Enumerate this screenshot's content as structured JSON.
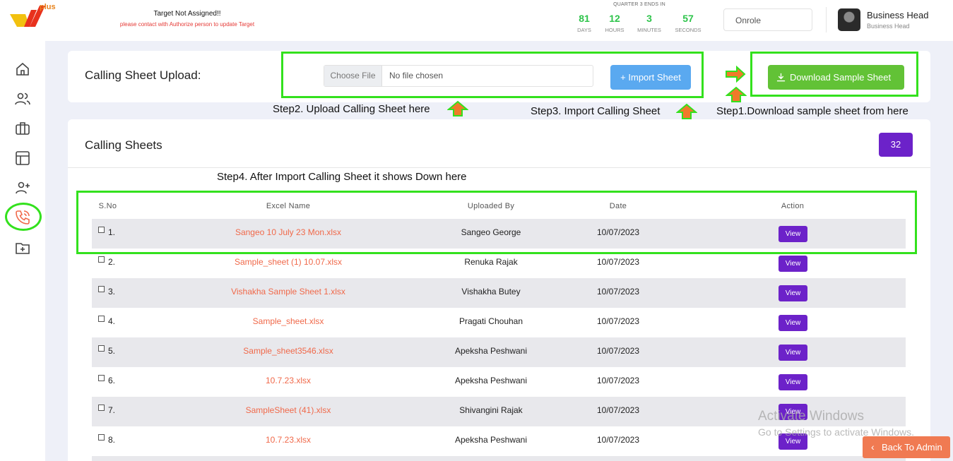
{
  "brand": {
    "logo_icon": "w-plus-logo",
    "plus_text": "plus"
  },
  "target": {
    "title": "Target Not Assigned!!",
    "subtitle": "please contact with Authorize person to update Target"
  },
  "countdown": {
    "heading": "QUARTER 3 ENDS IN",
    "units": [
      {
        "value": "81",
        "label": "DAYS"
      },
      {
        "value": "12",
        "label": "HOURS"
      },
      {
        "value": "3",
        "label": "MINUTES"
      },
      {
        "value": "57",
        "label": "SECONDS"
      }
    ]
  },
  "status_select": {
    "value": "Onrole"
  },
  "user": {
    "name": "Business Head",
    "role": "Business Head"
  },
  "sidebar": {
    "items": [
      {
        "icon": "home-icon"
      },
      {
        "icon": "users-icon"
      },
      {
        "icon": "briefcase-icon"
      },
      {
        "icon": "layout-icon"
      },
      {
        "icon": "add-user-icon"
      },
      {
        "icon": "phone-call-icon",
        "active": true
      },
      {
        "icon": "folder-plus-icon"
      }
    ]
  },
  "upload": {
    "title": "Calling Sheet Upload:",
    "choose_label": "Choose File",
    "no_file": "No file chosen",
    "import_label": "+ Import Sheet",
    "download_label": "Download Sample Sheet"
  },
  "annotations": {
    "step1": "Step1.Download sample sheet from here",
    "step2": "Step2. Upload Calling Sheet here",
    "step3": "Step3. Import Calling Sheet",
    "step4": "Step4. After Import Calling Sheet it shows Down here"
  },
  "sheets": {
    "title": "Calling Sheets",
    "count": "32",
    "columns": [
      "S.No",
      "Excel Name",
      "Uploaded By",
      "Date",
      "Action"
    ],
    "view_label": "View",
    "rows": [
      {
        "sno": "1.",
        "file": "Sangeo 10 July 23 Mon.xlsx",
        "by": "Sangeo George",
        "date": "10/07/2023"
      },
      {
        "sno": "2.",
        "file": "Sample_sheet (1) 10.07.xlsx",
        "by": "Renuka Rajak",
        "date": "10/07/2023"
      },
      {
        "sno": "3.",
        "file": "Vishakha Sample Sheet 1.xlsx",
        "by": "Vishakha Butey",
        "date": "10/07/2023"
      },
      {
        "sno": "4.",
        "file": "Sample_sheet.xlsx",
        "by": "Pragati Chouhan",
        "date": "10/07/2023"
      },
      {
        "sno": "5.",
        "file": "Sample_sheet3546.xlsx",
        "by": "Apeksha Peshwani",
        "date": "10/07/2023"
      },
      {
        "sno": "6.",
        "file": "10.7.23.xlsx",
        "by": "Apeksha Peshwani",
        "date": "10/07/2023"
      },
      {
        "sno": "7.",
        "file": "SampleSheet (41).xlsx",
        "by": "Shivangini Rajak",
        "date": "10/07/2023"
      },
      {
        "sno": "8.",
        "file": "10.7.23.xlsx",
        "by": "Apeksha Peshwani",
        "date": "10/07/2023"
      }
    ]
  },
  "watermark": {
    "line1": "Activate Windows",
    "line2": "Go to Settings to activate Windows."
  },
  "back_button": {
    "label": "Back To Admin"
  },
  "colors": {
    "accent_purple": "#6c22c9",
    "import_blue": "#5aa9f0",
    "download_green": "#62c236",
    "annotation_green": "#33e11d",
    "annotation_arrow": "#f07a2a",
    "file_link": "#f0694a",
    "countdown_green": "#2ec44b"
  }
}
